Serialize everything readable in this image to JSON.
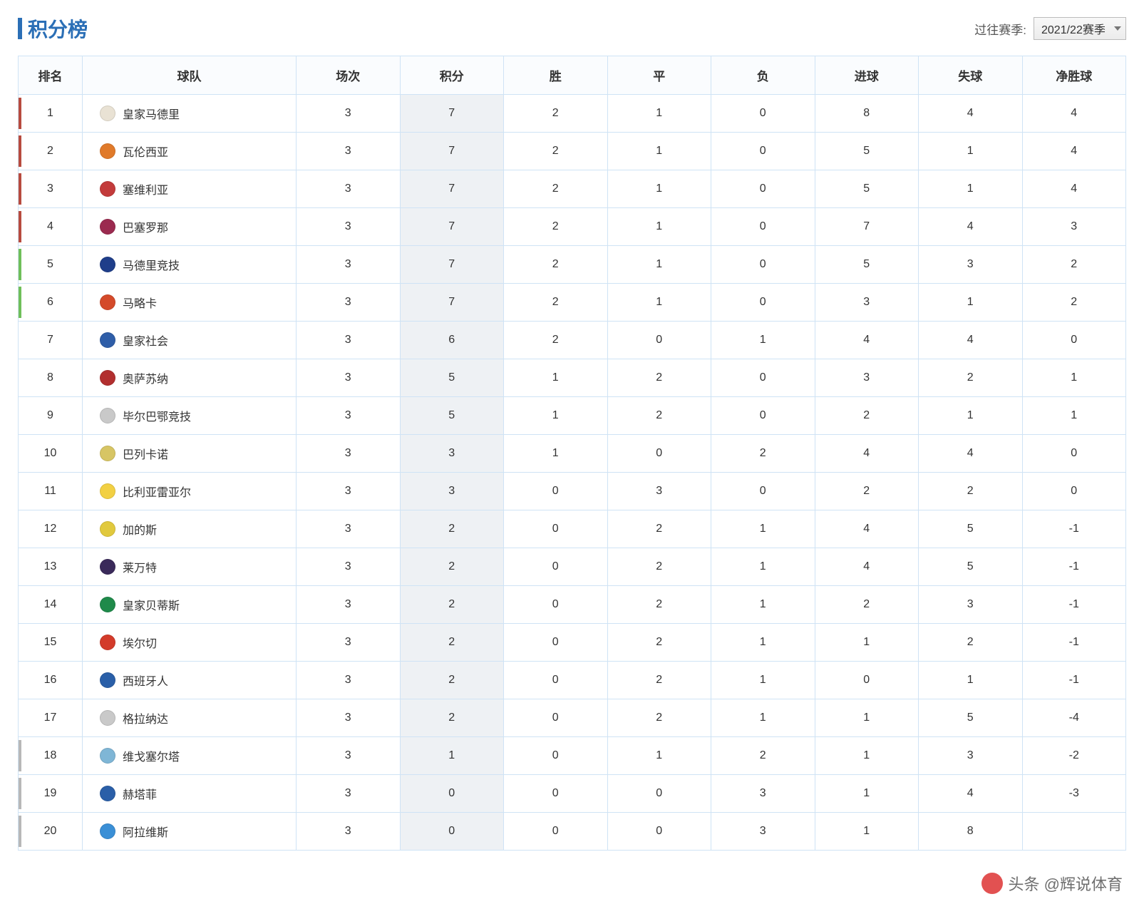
{
  "header": {
    "title": "积分榜",
    "season_label": "过往赛季:",
    "season_value": "2021/22赛季"
  },
  "columns": {
    "rank": "排名",
    "team": "球队",
    "played": "场次",
    "points": "积分",
    "wins": "胜",
    "draws": "平",
    "losses": "负",
    "gf": "进球",
    "ga": "失球",
    "gd": "净胜球"
  },
  "rows": [
    {
      "rank": "1",
      "bar": "bar-red",
      "icon": "#e9e2d4",
      "team": "皇家马德里",
      "played": "3",
      "points": "7",
      "wins": "2",
      "draws": "1",
      "losses": "0",
      "gf": "8",
      "ga": "4",
      "gd": "4"
    },
    {
      "rank": "2",
      "bar": "bar-red",
      "icon": "#e07a2a",
      "team": "瓦伦西亚",
      "played": "3",
      "points": "7",
      "wins": "2",
      "draws": "1",
      "losses": "0",
      "gf": "5",
      "ga": "1",
      "gd": "4"
    },
    {
      "rank": "3",
      "bar": "bar-red",
      "icon": "#c33b3b",
      "team": "塞维利亚",
      "played": "3",
      "points": "7",
      "wins": "2",
      "draws": "1",
      "losses": "0",
      "gf": "5",
      "ga": "1",
      "gd": "4"
    },
    {
      "rank": "4",
      "bar": "bar-red",
      "icon": "#9b2a4f",
      "team": "巴塞罗那",
      "played": "3",
      "points": "7",
      "wins": "2",
      "draws": "1",
      "losses": "0",
      "gf": "7",
      "ga": "4",
      "gd": "3"
    },
    {
      "rank": "5",
      "bar": "bar-green",
      "icon": "#1f3e8a",
      "team": "马德里竞技",
      "played": "3",
      "points": "7",
      "wins": "2",
      "draws": "1",
      "losses": "0",
      "gf": "5",
      "ga": "3",
      "gd": "2"
    },
    {
      "rank": "6",
      "bar": "bar-green",
      "icon": "#d44a2a",
      "team": "马略卡",
      "played": "3",
      "points": "7",
      "wins": "2",
      "draws": "1",
      "losses": "0",
      "gf": "3",
      "ga": "1",
      "gd": "2"
    },
    {
      "rank": "7",
      "bar": "",
      "icon": "#2f5ea8",
      "team": "皇家社会",
      "played": "3",
      "points": "6",
      "wins": "2",
      "draws": "0",
      "losses": "1",
      "gf": "4",
      "ga": "4",
      "gd": "0"
    },
    {
      "rank": "8",
      "bar": "",
      "icon": "#b22f2f",
      "team": "奥萨苏纳",
      "played": "3",
      "points": "5",
      "wins": "1",
      "draws": "2",
      "losses": "0",
      "gf": "3",
      "ga": "2",
      "gd": "1"
    },
    {
      "rank": "9",
      "bar": "",
      "icon": "#c9c9c9",
      "team": "毕尔巴鄂竞技",
      "played": "3",
      "points": "5",
      "wins": "1",
      "draws": "2",
      "losses": "0",
      "gf": "2",
      "ga": "1",
      "gd": "1"
    },
    {
      "rank": "10",
      "bar": "",
      "icon": "#d7c564",
      "team": "巴列卡诺",
      "played": "3",
      "points": "3",
      "wins": "1",
      "draws": "0",
      "losses": "2",
      "gf": "4",
      "ga": "4",
      "gd": "0"
    },
    {
      "rank": "11",
      "bar": "",
      "icon": "#f2d043",
      "team": "比利亚雷亚尔",
      "played": "3",
      "points": "3",
      "wins": "0",
      "draws": "3",
      "losses": "0",
      "gf": "2",
      "ga": "2",
      "gd": "0"
    },
    {
      "rank": "12",
      "bar": "",
      "icon": "#e1c93d",
      "team": "加的斯",
      "played": "3",
      "points": "2",
      "wins": "0",
      "draws": "2",
      "losses": "1",
      "gf": "4",
      "ga": "5",
      "gd": "-1"
    },
    {
      "rank": "13",
      "bar": "",
      "icon": "#3a2a5a",
      "team": "莱万特",
      "played": "3",
      "points": "2",
      "wins": "0",
      "draws": "2",
      "losses": "1",
      "gf": "4",
      "ga": "5",
      "gd": "-1"
    },
    {
      "rank": "14",
      "bar": "",
      "icon": "#1f8a4a",
      "team": "皇家贝蒂斯",
      "played": "3",
      "points": "2",
      "wins": "0",
      "draws": "2",
      "losses": "1",
      "gf": "2",
      "ga": "3",
      "gd": "-1"
    },
    {
      "rank": "15",
      "bar": "",
      "icon": "#d33b2a",
      "team": "埃尔切",
      "played": "3",
      "points": "2",
      "wins": "0",
      "draws": "2",
      "losses": "1",
      "gf": "1",
      "ga": "2",
      "gd": "-1"
    },
    {
      "rank": "16",
      "bar": "",
      "icon": "#2a5fa8",
      "team": "西班牙人",
      "played": "3",
      "points": "2",
      "wins": "0",
      "draws": "2",
      "losses": "1",
      "gf": "0",
      "ga": "1",
      "gd": "-1"
    },
    {
      "rank": "17",
      "bar": "",
      "icon": "#c9c9c9",
      "team": "格拉纳达",
      "played": "3",
      "points": "2",
      "wins": "0",
      "draws": "2",
      "losses": "1",
      "gf": "1",
      "ga": "5",
      "gd": "-4"
    },
    {
      "rank": "18",
      "bar": "bar-gray",
      "icon": "#7fb6d6",
      "team": "维戈塞尔塔",
      "played": "3",
      "points": "1",
      "wins": "0",
      "draws": "1",
      "losses": "2",
      "gf": "1",
      "ga": "3",
      "gd": "-2"
    },
    {
      "rank": "19",
      "bar": "bar-gray",
      "icon": "#2a5fa8",
      "team": "赫塔菲",
      "played": "3",
      "points": "0",
      "wins": "0",
      "draws": "0",
      "losses": "3",
      "gf": "1",
      "ga": "4",
      "gd": "-3"
    },
    {
      "rank": "20",
      "bar": "bar-gray",
      "icon": "#3a8fd6",
      "team": "阿拉维斯",
      "played": "3",
      "points": "0",
      "wins": "0",
      "draws": "0",
      "losses": "3",
      "gf": "1",
      "ga": "8",
      "gd": ""
    }
  ],
  "watermark": "头条 @辉说体育"
}
